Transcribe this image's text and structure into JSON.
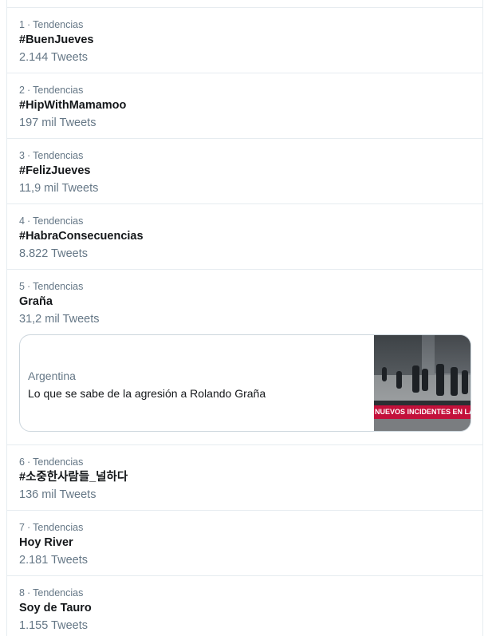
{
  "trends": [
    {
      "rank": "1",
      "sep": "·",
      "category": "Tendencias",
      "name": "#BuenJueves",
      "count": "2.144 Tweets"
    },
    {
      "rank": "2",
      "sep": "·",
      "category": "Tendencias",
      "name": "#HipWithMamamoo",
      "count": "197 mil Tweets"
    },
    {
      "rank": "3",
      "sep": "·",
      "category": "Tendencias",
      "name": "#FelizJueves",
      "count": "11,9 mil Tweets"
    },
    {
      "rank": "4",
      "sep": "·",
      "category": "Tendencias",
      "name": "#HabraConsecuencias",
      "count": "8.822 Tweets"
    },
    {
      "rank": "5",
      "sep": "·",
      "category": "Tendencias",
      "name": "Graña",
      "count": "31,2 mil Tweets",
      "card": {
        "source": "Argentina",
        "headline": "Lo que se sabe de la agresión a Rolando Graña",
        "thumbnail_banner": "NUEVOS INCIDENTES EN LAS CALLES D"
      }
    },
    {
      "rank": "6",
      "sep": "·",
      "category": "Tendencias",
      "name": "#소중한사람들_널하다",
      "count": "136 mil Tweets"
    },
    {
      "rank": "7",
      "sep": "·",
      "category": "Tendencias",
      "name": "Hoy River",
      "count": "2.181 Tweets"
    },
    {
      "rank": "8",
      "sep": "·",
      "category": "Tendencias",
      "name": "Soy de Tauro",
      "count": "1.155 Tweets"
    }
  ],
  "colors": {
    "primary_text": "#14171a",
    "secondary_text": "#657786",
    "border": "#e6ecf0",
    "card_border": "#ccd6dd",
    "banner": "#c3113b"
  }
}
